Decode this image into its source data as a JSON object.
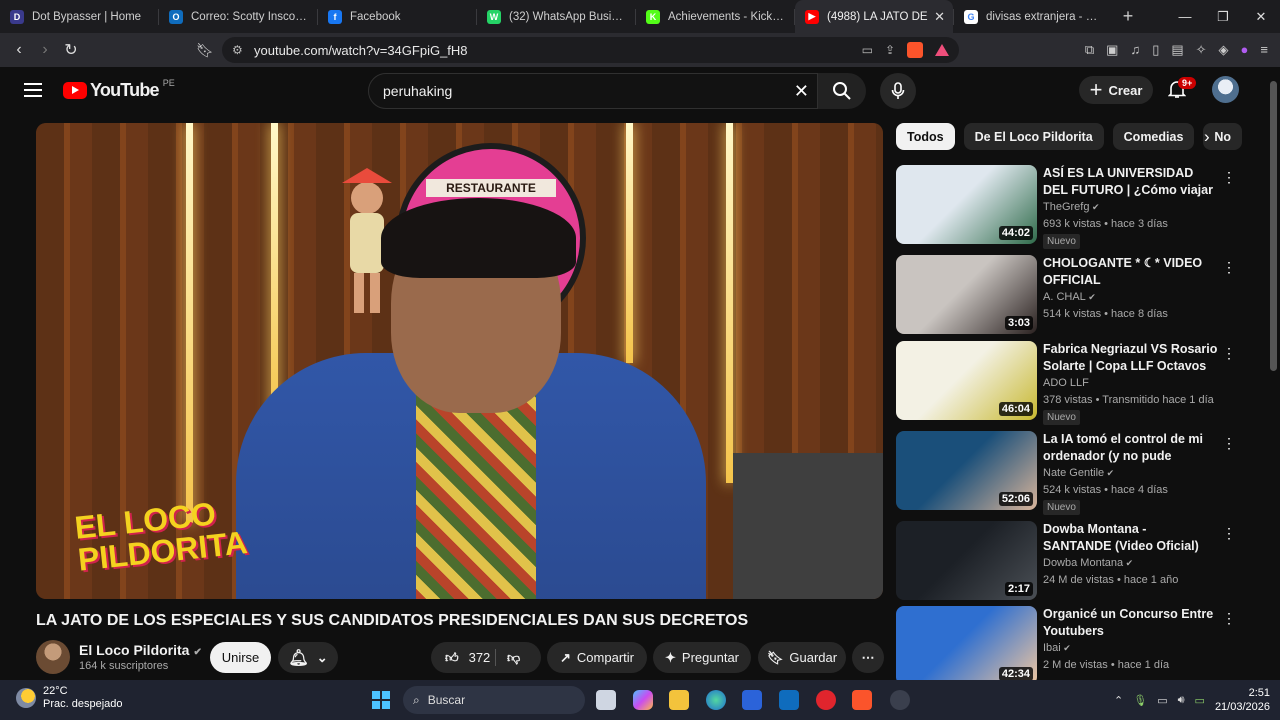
{
  "browser": {
    "tabs": [
      {
        "title": "Dot Bypasser | Home",
        "fav_color": "#3a3a8c",
        "fav_text": "D"
      },
      {
        "title": "Correo: Scotty Inscore - Ou",
        "fav_color": "#0f6cbd",
        "fav_text": "O"
      },
      {
        "title": "Facebook",
        "fav_color": "#1877f2",
        "fav_text": "f"
      },
      {
        "title": "(32) WhatsApp Business",
        "fav_color": "#25d366",
        "fav_text": "W"
      },
      {
        "title": "Achievements - Kick Dashb",
        "fav_color": "#53fc18",
        "fav_text": "K"
      },
      {
        "title": "(4988) LA JATO DE",
        "fav_color": "#ff0000",
        "fav_text": "▶",
        "active": true
      },
      {
        "title": "divisas extranjera - Buscar",
        "fav_color": "#ffffff",
        "fav_text": "G"
      }
    ],
    "new_tab": "+",
    "url": "youtube.com/watch?v=34GFpiG_fH8",
    "brave_count": "9+"
  },
  "youtube": {
    "logo_word": "YouTube",
    "country": "PE",
    "search_value": "peruhaking",
    "create_label": "Crear",
    "notif_badge": "9+"
  },
  "video": {
    "sign_text": "RESTAURANTE TIPICO",
    "brand_line1": "EL LOCO",
    "brand_line2": "PILDORITA",
    "title": "LA JATO DE LOS ESPECIALES Y SUS CANDIDATOS PRESIDENCIALES DAN SUS DECRETOS",
    "channel": "El Loco Pildorita",
    "subscribers": "164 k suscriptores",
    "join_label": "Unirse",
    "likes": "372",
    "share_label": "Compartir",
    "ask_label": "Preguntar",
    "save_label": "Guardar"
  },
  "chips": [
    "Todos",
    "De El Loco Pildorita",
    "Comedias",
    "No"
  ],
  "recommendations": [
    {
      "title": "ASÍ ES LA UNIVERSIDAD DEL FUTURO | ¿Cómo viajar y gana...",
      "channel": "TheGrefg",
      "verified": true,
      "meta": "693 k vistas • hace 3 días",
      "duration": "44:02",
      "badge": "Nuevo",
      "thumb_a": "#dfe7ee",
      "thumb_b": "#2f6b4a"
    },
    {
      "title": "CHOLOGANTE * ☾* VIDEO OFFICIAL",
      "channel": "A. CHAL",
      "verified": true,
      "meta": "514 k vistas • hace 8 días",
      "duration": "3:03",
      "badge": "",
      "thumb_a": "#c9c4c0",
      "thumb_b": "#2a2120"
    },
    {
      "title": "Fabrica Negriazul VS Rosario Solarte | Copa LLF Octavos",
      "channel": "ADO LLF",
      "verified": false,
      "meta": "378 vistas • Transmitido hace 1 día",
      "duration": "46:04",
      "badge": "Nuevo",
      "thumb_a": "#f3f1e4",
      "thumb_b": "#c7b830"
    },
    {
      "title": "La IA tomó el control de mi ordenador (y no pude pararlo)",
      "channel": "Nate Gentile",
      "verified": true,
      "meta": "524 k vistas • hace 4 días",
      "duration": "52:06",
      "badge": "Nuevo",
      "thumb_a": "#1a4f7a",
      "thumb_b": "#d8b49a"
    },
    {
      "title": "Dowba Montana - SANTANDE (Video Oficial)",
      "channel": "Dowba Montana",
      "verified": true,
      "meta": "24 M de vistas • hace 1 año",
      "duration": "2:17",
      "badge": "",
      "thumb_a": "#1c2026",
      "thumb_b": "#4a4f55"
    },
    {
      "title": "Organicé un Concurso Entre Youtubers",
      "channel": "Ibai",
      "verified": true,
      "meta": "2 M de vistas • hace 1 día",
      "duration": "42:34",
      "badge": "",
      "thumb_a": "#2f6fd0",
      "thumb_b": "#f0c7a0"
    }
  ],
  "taskbar": {
    "temp": "22°C",
    "weather": "Prac. despejado",
    "search": "Buscar",
    "time": "2:51",
    "date": "21/03/2026"
  }
}
